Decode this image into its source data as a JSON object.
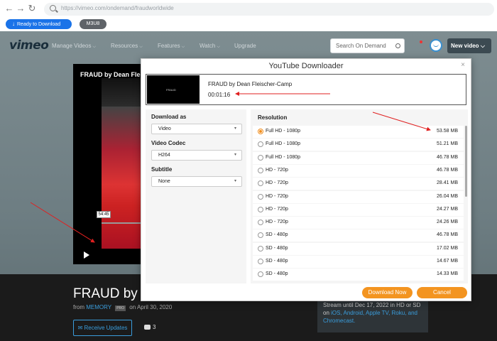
{
  "browser": {
    "url": "https://vimeo.com/ondemand/fraudworldwide"
  },
  "extension": {
    "ready_label": "Ready to Download",
    "m3u8_label": "M3U8"
  },
  "vimeo_nav": {
    "logo": "vimeo",
    "items": [
      {
        "label": "Manage Videos",
        "caret": true
      },
      {
        "label": "Resources",
        "caret": true
      },
      {
        "label": "Features",
        "caret": true
      },
      {
        "label": "Watch",
        "caret": true
      },
      {
        "label": "Upgrade",
        "caret": false
      }
    ],
    "search_placeholder": "Search On Demand",
    "new_video": "New video"
  },
  "player": {
    "title": "FRAUD by Dean Fle",
    "time_tooltip": "54:45"
  },
  "film": {
    "title": "FRAUD by",
    "from_prefix": "from",
    "owner": "MEMORY",
    "badge": "PRO",
    "date_text": "on April 30, 2020",
    "receive_updates": "Receive Updates",
    "comment_count": "3",
    "stream_text": "Stream until Dec 17, 2022 in HD or SD on",
    "stream_platforms": "iOS, Android, Apple TV, Roku, and Chromecast."
  },
  "downloader": {
    "title": "YouTube Downloader",
    "close": "×",
    "thumb_text": "FRAUD",
    "video_name": "FRAUD by Dean Fleischer-Camp",
    "duration": "00:01:16",
    "download_as_label": "Download as",
    "download_as_value": "Video",
    "codec_label": "Video Codec",
    "codec_value": "H264",
    "subtitle_label": "Subtitle",
    "subtitle_value": "None",
    "resolution_label": "Resolution",
    "resolutions": [
      {
        "quality": "Full HD - 1080p",
        "size": "53.58 MB",
        "selected": true
      },
      {
        "quality": "Full HD - 1080p",
        "size": "51.21 MB",
        "selected": false
      },
      {
        "quality": "Full HD - 1080p",
        "size": "46.78 MB",
        "selected": false
      },
      {
        "quality": "HD - 720p",
        "size": "46.78 MB",
        "selected": false
      },
      {
        "quality": "HD - 720p",
        "size": "28.41 MB",
        "selected": false
      },
      {
        "quality": "HD - 720p",
        "size": "26.04 MB",
        "selected": false
      },
      {
        "quality": "HD - 720p",
        "size": "24.27 MB",
        "selected": false
      },
      {
        "quality": "HD - 720p",
        "size": "24.26 MB",
        "selected": false
      },
      {
        "quality": "SD - 480p",
        "size": "46.78 MB",
        "selected": false
      },
      {
        "quality": "SD - 480p",
        "size": "17.02 MB",
        "selected": false
      },
      {
        "quality": "SD - 480p",
        "size": "14.67 MB",
        "selected": false
      },
      {
        "quality": "SD - 480p",
        "size": "14.33 MB",
        "selected": false
      }
    ],
    "download_now": "Download Now",
    "cancel": "Cancel"
  },
  "colors": {
    "accent_orange": "#f39420",
    "ext_blue": "#1a73e8",
    "annotation_red": "#e02020",
    "vimeo_link": "#3a9ddc"
  }
}
